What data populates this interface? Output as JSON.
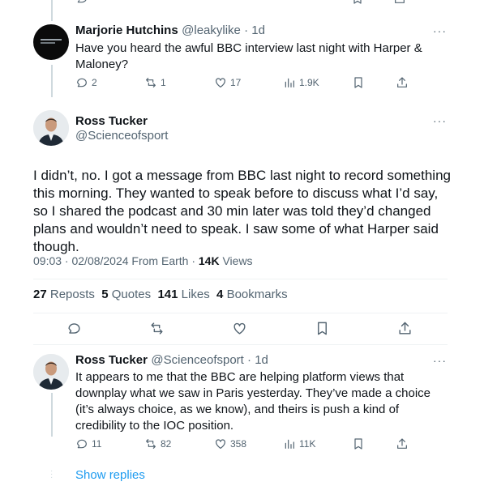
{
  "tweet1": {
    "name": "Marjorie Hutchins",
    "handle": "@leakylike",
    "time": "1d",
    "text": "Have you heard the awful BBC interview last night with Harper & Maloney?",
    "replies": "2",
    "reposts": "1",
    "likes": "17",
    "views": "1.9K",
    "more": "···"
  },
  "main_tweet": {
    "name": "Ross Tucker",
    "handle": "@Scienceofsport",
    "more": "···",
    "text": "I didn’t, no. I got a message from BBC last night to record something this morning. They wanted to speak before to discuss what I’d say, so I shared the podcast and 30 min later was told they’d changed plans and wouldn’t need to speak. I saw some of what Harper said though.",
    "timestamp": "09:03 · 02/08/2024 From Earth ·",
    "views_count": "14K",
    "views_label": "Views",
    "reposts_count": "27",
    "reposts_label": "Reposts",
    "quotes_count": "5",
    "quotes_label": "Quotes",
    "likes_count": "141",
    "likes_label": "Likes",
    "bookmarks_count": "4",
    "bookmarks_label": "Bookmarks"
  },
  "tweet3": {
    "name": "Ross Tucker",
    "handle": "@Scienceofsport",
    "time": "1d",
    "text": "It appears to me that the BBC are helping platform views that downplay what we saw in Paris yesterday. They’ve made a choice (it’s always choice, as we know), and theirs is push a kind of credibility to the IOC position.",
    "replies": "11",
    "reposts": "82",
    "likes": "358",
    "views": "11K",
    "more": "···"
  },
  "show_replies": "Show replies",
  "icons": [
    "reply-icon",
    "repost-icon",
    "like-icon",
    "views-icon",
    "bookmark-icon",
    "share-icon",
    "more-icon"
  ]
}
